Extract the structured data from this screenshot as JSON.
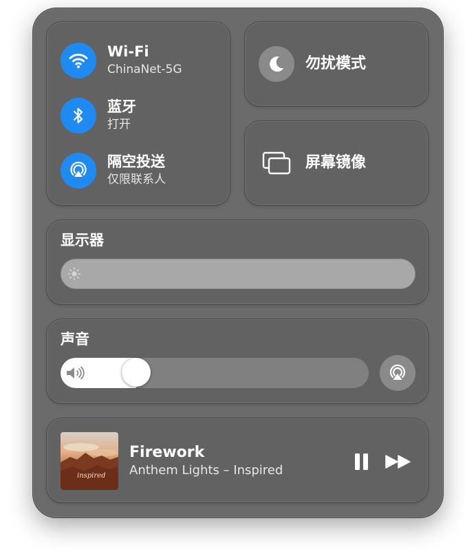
{
  "network": {
    "wifi": {
      "title": "Wi-Fi",
      "subtitle": "ChinaNet-5G",
      "icon": "wifi-icon",
      "color": "#1f8bf0"
    },
    "bluetooth": {
      "title": "蓝牙",
      "subtitle": "打开",
      "icon": "bluetooth-icon",
      "color": "#1f8bf0"
    },
    "airdrop": {
      "title": "隔空投送",
      "subtitle": "仅限联系人",
      "icon": "airdrop-icon",
      "color": "#1f8bf0"
    }
  },
  "focus": {
    "label": "勿扰模式",
    "icon": "moon-icon"
  },
  "screen_mirroring": {
    "label": "屏幕镜像",
    "icon": "screen-mirroring-icon"
  },
  "display": {
    "title": "显示器",
    "brightness": 0.0,
    "icon": "brightness-icon"
  },
  "sound": {
    "title": "声音",
    "volume": 0.22,
    "icon": "speaker-icon",
    "output_icon": "airplay-audio-icon"
  },
  "now_playing": {
    "title": "Firework",
    "artist": "Anthem Lights – Inspired",
    "album_text": "inspired"
  }
}
